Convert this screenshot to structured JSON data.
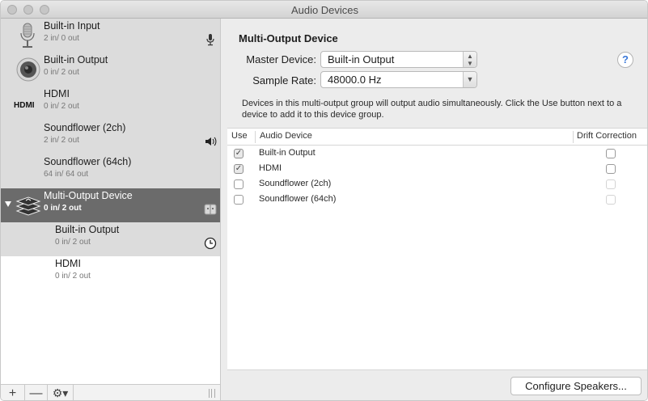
{
  "window": {
    "title": "Audio Devices"
  },
  "devices": [
    {
      "name": "Built-in Input",
      "io": "2 in/ 0 out",
      "icon": "microphone-icon",
      "right_icon": "mic-small-icon"
    },
    {
      "name": "Built-in Output",
      "io": "0 in/ 2 out",
      "icon": "speaker-icon"
    },
    {
      "name": "HDMI",
      "io": "0 in/ 2 out",
      "icon": "hdmi-icon",
      "icon_text": "HDMI"
    },
    {
      "name": "Soundflower (2ch)",
      "io": "2 in/ 2 out",
      "right_icon": "volume-icon"
    },
    {
      "name": "Soundflower (64ch)",
      "io": "64 in/ 64 out"
    },
    {
      "name": "Multi-Output Device",
      "io": "0 in/ 2 out",
      "icon": "multi-output-icon",
      "right_icon": "finder-icon",
      "selected": true
    },
    {
      "name": "Built-in Output",
      "io": "0 in/ 2 out",
      "right_icon": "clock-icon",
      "child": true
    },
    {
      "name": "HDMI",
      "io": "0 in/ 2 out",
      "child": true
    }
  ],
  "sidebar_footer": {
    "add": "+",
    "remove": "—",
    "gear": "⚙▾"
  },
  "panel": {
    "title": "Multi-Output Device",
    "master_label": "Master Device:",
    "master_value": "Built-in Output",
    "rate_label": "Sample Rate:",
    "rate_value": "48000.0 Hz",
    "help": "?",
    "description": "Devices in this multi-output group will output audio simultaneously. Click the Use button next to a device to add it to this device group."
  },
  "table": {
    "headers": {
      "use": "Use",
      "device": "Audio Device",
      "drift": "Drift Correction"
    },
    "rows": [
      {
        "name": "Built-in Output",
        "use": true,
        "drift": false,
        "drift_enabled": true
      },
      {
        "name": "HDMI",
        "use": true,
        "drift": false,
        "drift_enabled": true
      },
      {
        "name": "Soundflower (2ch)",
        "use": false,
        "drift": false,
        "drift_enabled": false
      },
      {
        "name": "Soundflower (64ch)",
        "use": false,
        "drift": false,
        "drift_enabled": false
      }
    ]
  },
  "configure_button": "Configure Speakers..."
}
